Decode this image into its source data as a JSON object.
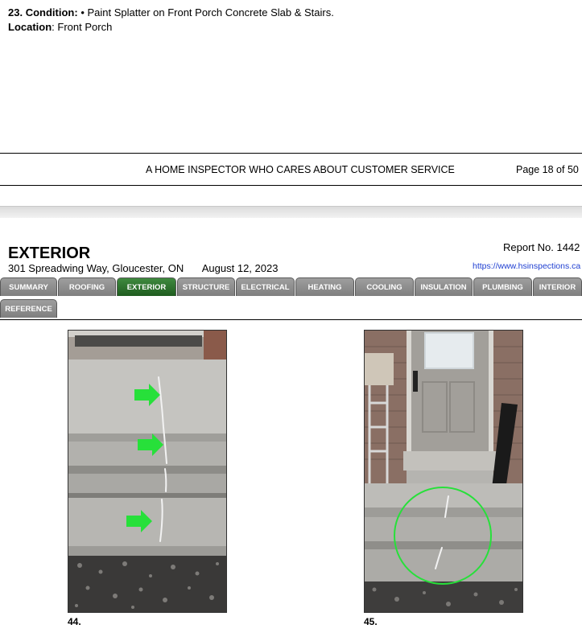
{
  "condition": {
    "number": "23.",
    "label": "Condition:",
    "text": "• Paint Splatter on Front Porch Concrete Slab & Stairs.",
    "location_label": "Location",
    "location_text": ": Front Porch"
  },
  "footer": {
    "tagline": "A HOME INSPECTOR WHO CARES ABOUT CUSTOMER SERVICE",
    "page": "Page 18 of 50"
  },
  "header": {
    "section_title": "EXTERIOR",
    "address": "301 Spreadwing Way, Gloucester, ON",
    "date": "August 12, 2023",
    "report_no": "Report No. 1442",
    "url": "https://www.hsinspections.ca"
  },
  "tabs": [
    {
      "label": "SUMMARY",
      "active": false
    },
    {
      "label": "ROOFING",
      "active": false
    },
    {
      "label": "EXTERIOR",
      "active": true
    },
    {
      "label": "STRUCTURE",
      "active": false
    },
    {
      "label": "ELECTRICAL",
      "active": false
    },
    {
      "label": "HEATING",
      "active": false
    },
    {
      "label": "COOLING",
      "active": false
    },
    {
      "label": "INSULATION",
      "active": false
    },
    {
      "label": "PLUMBING",
      "active": false
    },
    {
      "label": "INTERIOR",
      "active": false
    },
    {
      "label": "REFERENCE",
      "active": false
    }
  ],
  "photos": [
    {
      "caption": "44."
    },
    {
      "caption": "45."
    }
  ],
  "colors": {
    "active_tab": "#2e6f2e",
    "inactive_tab": "#8c8c8c",
    "marker_green": "#27e03a",
    "link": "#1f3fd1"
  }
}
